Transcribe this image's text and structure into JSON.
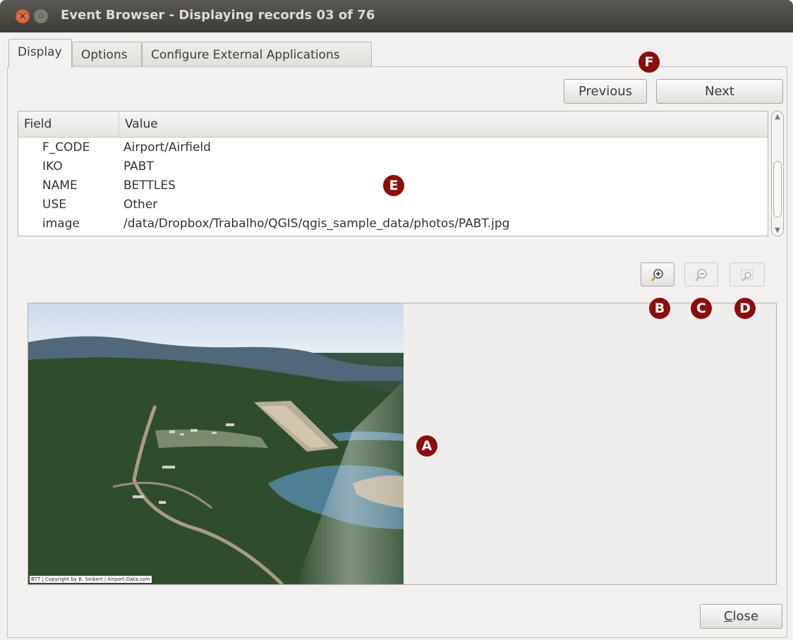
{
  "window": {
    "title": "Event Browser - Displaying records 03 of 76",
    "close_glyph": "×",
    "max_glyph": "▫"
  },
  "tabs": [
    {
      "label": "Display",
      "active": true
    },
    {
      "label": "Options",
      "active": false
    },
    {
      "label": "Configure External Applications",
      "active": false
    }
  ],
  "nav": {
    "previous_label": "Previous",
    "next_label": "Next"
  },
  "table": {
    "headers": {
      "field": "Field",
      "value": "Value"
    },
    "rows": [
      {
        "field": "F_CODE",
        "value": "Airport/Airfield"
      },
      {
        "field": "IKO",
        "value": "PABT"
      },
      {
        "field": "NAME",
        "value": "BETTLES"
      },
      {
        "field": "USE",
        "value": "Other"
      },
      {
        "field": "image",
        "value": "/data/Dropbox/Trabalho/QGIS/qgis_sample_data/photos/PABT.jpg"
      }
    ]
  },
  "zoom": {
    "zoom_in_icon": "zoom-in-icon",
    "zoom_out_icon": "zoom-out-icon",
    "fit_icon": "zoom-fit-icon"
  },
  "photo": {
    "caption": "BTT | Copyright by B. Seibert | Airport-Data.com"
  },
  "footer": {
    "close_label_first": "C",
    "close_label_rest": "lose"
  },
  "markers": {
    "a": "A",
    "b": "B",
    "c": "C",
    "d": "D",
    "e": "E",
    "f": "F"
  },
  "colors": {
    "marker": "#8b0d0d",
    "titlebar": "#3c3b37",
    "window_bg": "#f2f1f0"
  }
}
